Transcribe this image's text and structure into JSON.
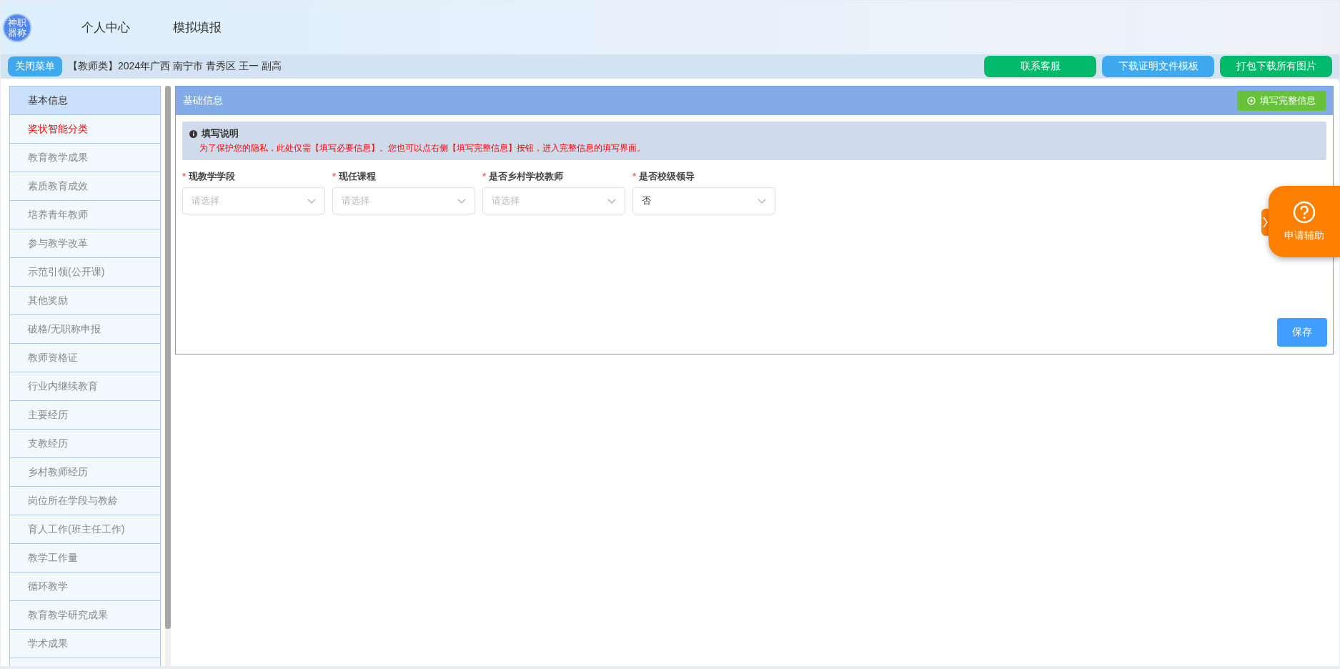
{
  "header": {
    "logo_text": "神职器称",
    "nav": [
      {
        "label": "个人中心"
      },
      {
        "label": "模拟填报"
      }
    ]
  },
  "toolbar": {
    "close_menu": "关闭菜单",
    "context": "【教师类】2024年广西 南宁市 青秀区 王一 副高",
    "buttons": [
      {
        "label": "联系客服",
        "kind": "green"
      },
      {
        "label": "下载证明文件模板",
        "kind": "blue"
      },
      {
        "label": "打包下载所有图片",
        "kind": "green"
      }
    ]
  },
  "sidebar": {
    "items": [
      {
        "label": "基本信息",
        "selected": true,
        "kind": "normal"
      },
      {
        "label": "奖状智能分类",
        "selected": false,
        "kind": "highlight"
      },
      {
        "label": "教育教学成果",
        "selected": false,
        "kind": "normal"
      },
      {
        "label": "素质教育成效",
        "selected": false,
        "kind": "normal"
      },
      {
        "label": "培养青年教师",
        "selected": false,
        "kind": "normal"
      },
      {
        "label": "参与教学改革",
        "selected": false,
        "kind": "normal"
      },
      {
        "label": "示范引领(公开课)",
        "selected": false,
        "kind": "normal"
      },
      {
        "label": "其他奖励",
        "selected": false,
        "kind": "normal"
      },
      {
        "label": "破格/无职称申报",
        "selected": false,
        "kind": "normal"
      },
      {
        "label": "教师资格证",
        "selected": false,
        "kind": "normal"
      },
      {
        "label": "行业内继续教育",
        "selected": false,
        "kind": "normal"
      },
      {
        "label": "主要经历",
        "selected": false,
        "kind": "normal"
      },
      {
        "label": "支教经历",
        "selected": false,
        "kind": "normal"
      },
      {
        "label": "乡村教师经历",
        "selected": false,
        "kind": "normal"
      },
      {
        "label": "岗位所在学段与教龄",
        "selected": false,
        "kind": "normal"
      },
      {
        "label": "育人工作(班主任工作)",
        "selected": false,
        "kind": "normal"
      },
      {
        "label": "教学工作量",
        "selected": false,
        "kind": "normal"
      },
      {
        "label": "循环教学",
        "selected": false,
        "kind": "normal"
      },
      {
        "label": "教育教学研究成果",
        "selected": false,
        "kind": "normal"
      },
      {
        "label": "学术成果",
        "selected": false,
        "kind": "normal"
      }
    ]
  },
  "panel": {
    "title": "基础信息",
    "fill_button": "填写完整信息",
    "notice": {
      "title": "填写说明",
      "text": "为了保护您的隐私，此处仅需【填写必要信息】。您也可以点右侧【填写完整信息】按钮，进入完整信息的填写界面。"
    },
    "fields": [
      {
        "required_mark": "*",
        "label": "现教学学段",
        "placeholder": "请选择"
      },
      {
        "required_mark": "*",
        "label": "现任课程",
        "placeholder": "请选择"
      },
      {
        "required_mark": "*",
        "label": "是否乡村学校教师",
        "placeholder": "请选择"
      },
      {
        "required_mark": "*",
        "label": "是否校级领导",
        "value": "否"
      }
    ],
    "save_button": "保存"
  },
  "help": {
    "label": "申请辅助"
  }
}
